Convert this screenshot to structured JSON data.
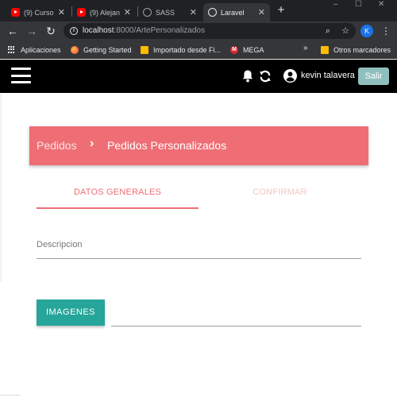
{
  "browser": {
    "tabs": [
      {
        "title": "(9) Curso",
        "icon": "youtube-icon",
        "active": false
      },
      {
        "title": "(9) Alejan",
        "icon": "youtube-icon",
        "active": false
      },
      {
        "title": "SASS",
        "icon": "globe-icon",
        "active": false
      },
      {
        "title": "Laravel",
        "icon": "globe-icon",
        "active": true
      }
    ],
    "new_tab": "+",
    "window_controls": {
      "minimize": "–",
      "maximize": "☐",
      "close": "✕"
    },
    "url_host": "localhost",
    "url_rest": ":8000/ArtePersonalizados",
    "profile_initial": "K",
    "bookmarks": [
      {
        "label": "Aplicaciones",
        "icon": "apps-grid-icon"
      },
      {
        "label": "Getting Started",
        "icon": "firefox-icon"
      },
      {
        "label": "Importado desde Fi...",
        "icon": "folder-icon"
      },
      {
        "label": "MEGA",
        "icon": "mega-icon"
      }
    ],
    "more_bookmarks": "»",
    "other_bookmarks": "Otros marcadores"
  },
  "navbar": {
    "username": "kevin talavera",
    "logout_label": "Salir",
    "icons": [
      "menu-icon",
      "bell-icon",
      "sync-icon",
      "account-icon"
    ]
  },
  "breadcrumb": {
    "items": [
      "Pedidos",
      "Pedidos Personalizados"
    ],
    "separator": "›"
  },
  "steps": [
    {
      "label": "DATOS GENERALES",
      "active": true
    },
    {
      "label": "CONFIRMAR",
      "active": false
    }
  ],
  "form": {
    "description_label": "Descripcion",
    "images_button": "IMAGENES"
  },
  "colors": {
    "accent": "#ef6e75",
    "teal": "#26a69a",
    "navbar": "#000000",
    "logout": "#8fbfbc"
  }
}
